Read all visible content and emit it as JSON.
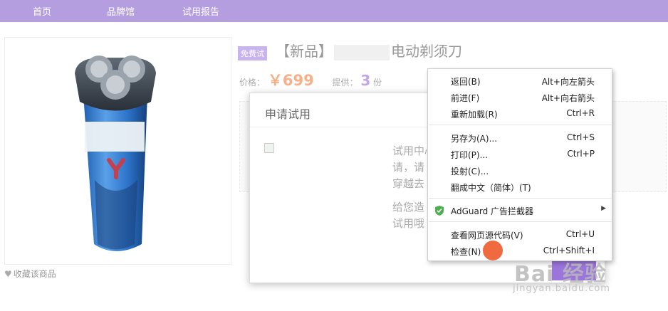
{
  "nav": {
    "items": [
      "首页",
      "品牌馆",
      "试用报告"
    ]
  },
  "product": {
    "badge": "免费试",
    "title_prefix": "【新品】",
    "title_suffix": "电动剃须刀",
    "price_label": "价格：",
    "price_value": "￥699",
    "supply_label": "提供：",
    "supply_value": "3",
    "supply_unit": "份",
    "favorite_label": "收藏该商品"
  },
  "modal": {
    "title": "申请试用",
    "lines": [
      "试用中心",
      "请，请",
      "穿越去",
      "给您造",
      "试用哦"
    ]
  },
  "context_menu": {
    "items": [
      {
        "label": "返回(B)",
        "shortcut": "Alt+向左箭头"
      },
      {
        "label": "前进(F)",
        "shortcut": "Alt+向右箭头"
      },
      {
        "label": "重新加载(R)",
        "shortcut": "Ctrl+R"
      },
      {
        "label": "另存为(A)...",
        "shortcut": "Ctrl+S"
      },
      {
        "label": "打印(P)...",
        "shortcut": "Ctrl+P"
      },
      {
        "label": "投射(C)...",
        "shortcut": ""
      },
      {
        "label": "翻成中文（简体）(T)",
        "shortcut": ""
      },
      {
        "label": "AdGuard 广告拦截器",
        "shortcut": ""
      },
      {
        "label": "查看网页源代码(V)",
        "shortcut": "Ctrl+U"
      },
      {
        "label": "检查(N)",
        "shortcut": "Ctrl+Shift+I"
      }
    ]
  },
  "watermark": {
    "main": "Bai 经验",
    "sub": "jingyan.baidu.com"
  },
  "colors": {
    "nav_bg": "#b59ee0",
    "price": "#f6b08a",
    "accent": "#9b74dc",
    "cursor": "#f06a3f"
  }
}
